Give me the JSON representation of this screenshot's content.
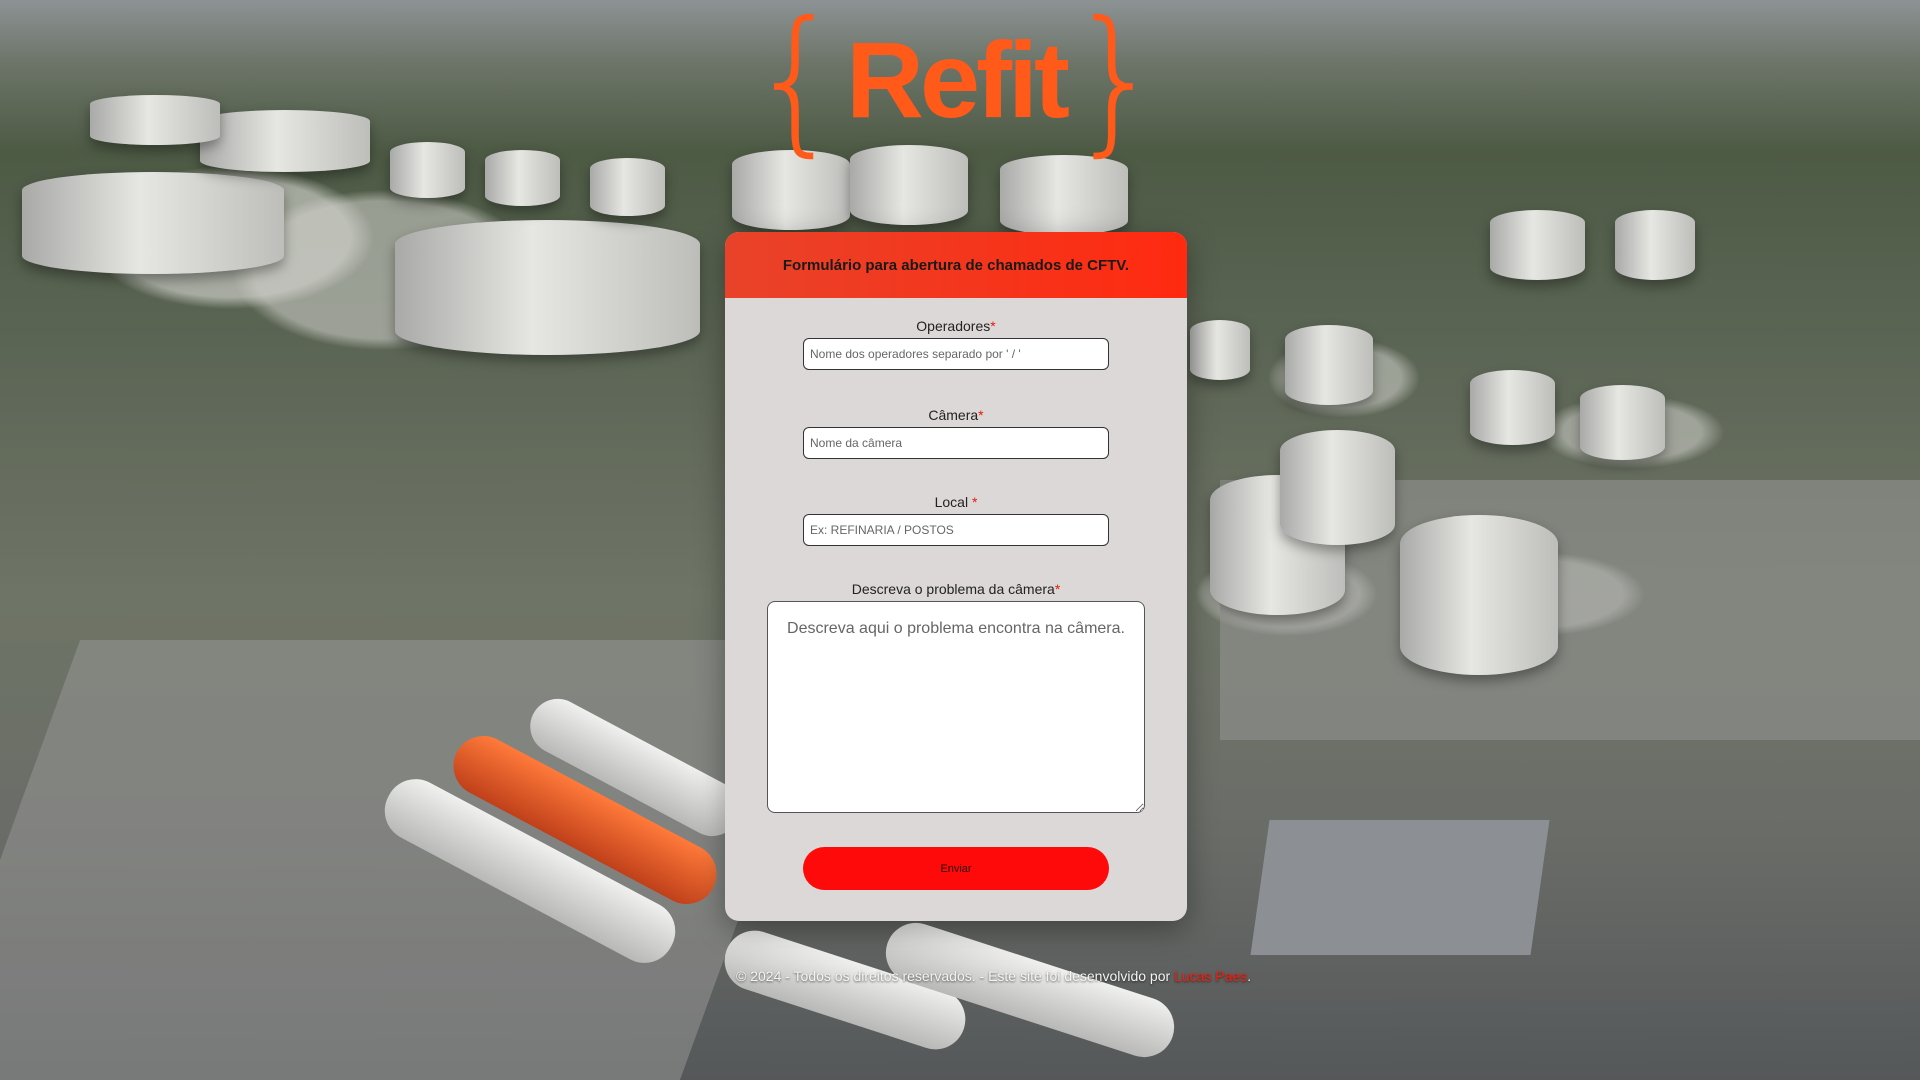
{
  "logo": {
    "brand": "Refit",
    "left_brace": "{",
    "right_brace": "}",
    "color": "#ff5a1a"
  },
  "form": {
    "title": "Formulário para abertura de chamados de CFTV.",
    "header_color": "#ff2a10",
    "fields": [
      {
        "label": "Operadores",
        "required_mark": "*",
        "placeholder": "Nome dos operadores separado por ' / '",
        "value": ""
      },
      {
        "label": "Câmera",
        "required_mark": "*",
        "placeholder": "Nome da câmera",
        "value": ""
      },
      {
        "label": "Local ",
        "required_mark": "*",
        "placeholder": "Ex: REFINARIA / POSTOS",
        "value": ""
      },
      {
        "label": "Descreva o problema da câmera",
        "required_mark": "*",
        "placeholder": "Descreva aqui o problema encontra na câmera.",
        "value": ""
      }
    ],
    "submit_label": "Enviar",
    "submit_color": "#ff0a0a"
  },
  "footer": {
    "text": "© 2024 - Todos os direitos reservados. - Este site foi desenvolvido por ",
    "author": "Lucas Paes",
    "suffix": "."
  }
}
